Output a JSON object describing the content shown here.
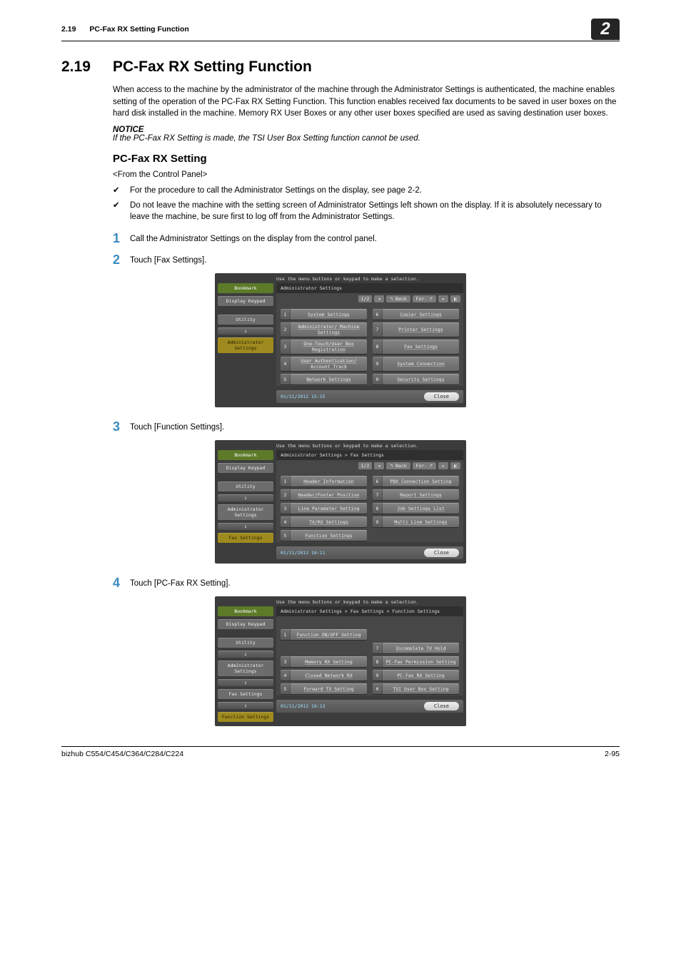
{
  "header": {
    "section_number": "2.19",
    "section_name": "PC-Fax RX Setting Function",
    "chapter_digit": "2"
  },
  "title": {
    "number": "2.19",
    "text": "PC-Fax RX Setting Function"
  },
  "intro": "When access to the machine by the administrator of the machine through the Administrator Settings is authenticated, the machine enables setting of the operation of the PC-Fax RX Setting Function. This function enables received fax documents to be saved in user boxes on the hard disk installed in the machine. Memory RX User Boxes or any other user boxes specified are used as saving destination user boxes.",
  "notice": {
    "label": "NOTICE",
    "text": "If the PC-Fax RX Setting is made, the TSI User Box Setting function cannot be used."
  },
  "subheading": "PC-Fax RX Setting",
  "origin": "<From the Control Panel>",
  "checks": [
    "For the procedure to call the Administrator Settings on the display, see page 2-2.",
    "Do not leave the machine with the setting screen of Administrator Settings left shown on the display. If it is absolutely necessary to leave the machine, be sure first to log off from the Administrator Settings."
  ],
  "steps": [
    {
      "n": "1",
      "text": "Call the Administrator Settings on the display from the control panel."
    },
    {
      "n": "2",
      "text": "Touch [Fax Settings]."
    },
    {
      "n": "3",
      "text": "Touch [Function Settings]."
    },
    {
      "n": "4",
      "text": "Touch [PC-Fax RX Setting]."
    }
  ],
  "common": {
    "hint": "Use the menu buttons or keypad to make a selection.",
    "bookmark": "Bookmark",
    "display_keypad": "Display Keypad",
    "utility": "Utility",
    "admin_settings": "Administrator Settings",
    "fax_settings": "Fax Settings",
    "function_settings": "Function Settings",
    "back": "↰ Back",
    "forw": "For- ↱",
    "close": "Close",
    "arrow_down": "↓"
  },
  "screen1": {
    "crumb": "Administrator Settings",
    "page": "1/2",
    "timestamp": "01/11/2012   15:15",
    "items": [
      {
        "n": "1",
        "t": "System Settings"
      },
      {
        "n": "6",
        "t": "Copier Settings"
      },
      {
        "n": "2",
        "t": "Administrator/ Machine Settings"
      },
      {
        "n": "7",
        "t": "Printer Settings"
      },
      {
        "n": "3",
        "t": "One-Touch/User Box Registration"
      },
      {
        "n": "8",
        "t": "Fax Settings"
      },
      {
        "n": "4",
        "t": "User Authentication/ Account Track"
      },
      {
        "n": "9",
        "t": "System Connection"
      },
      {
        "n": "5",
        "t": "Network Settings"
      },
      {
        "n": "0",
        "t": "Security Settings"
      }
    ]
  },
  "screen2": {
    "crumb": "Administrator Settings  >  Fax Settings",
    "page": "1/2",
    "timestamp": "01/11/2012   16:11",
    "items": [
      {
        "n": "1",
        "t": "Header Information"
      },
      {
        "n": "6",
        "t": "PBX Connection Setting"
      },
      {
        "n": "2",
        "t": "Header/Footer Position"
      },
      {
        "n": "7",
        "t": "Report Settings"
      },
      {
        "n": "3",
        "t": "Line Parameter Setting"
      },
      {
        "n": "8",
        "t": "Job Settings List"
      },
      {
        "n": "4",
        "t": "TX/RX Settings"
      },
      {
        "n": "9",
        "t": "Multi Line Settings"
      },
      {
        "n": "5",
        "t": "Function Settings"
      },
      {
        "n": "",
        "t": ""
      }
    ]
  },
  "screen3": {
    "crumb": "Administrator Settings > Fax Settings > Function Settings",
    "page": "",
    "timestamp": "01/11/2012   16:12",
    "items": [
      {
        "n": "1",
        "t": "Function ON/OFF Setting"
      },
      {
        "n": "",
        "t": ""
      },
      {
        "n": "",
        "t": ""
      },
      {
        "n": "7",
        "t": "Incomplete TX Hold"
      },
      {
        "n": "3",
        "t": "Memory RX Setting"
      },
      {
        "n": "8",
        "t": "PC-Fax Permission Setting"
      },
      {
        "n": "4",
        "t": "Closed Network RX"
      },
      {
        "n": "9",
        "t": "PC-Fax RX Setting"
      },
      {
        "n": "5",
        "t": "Forward TX Setting"
      },
      {
        "n": "0",
        "t": "TSI User Box Setting"
      }
    ]
  },
  "footer": {
    "model": "bizhub C554/C454/C364/C284/C224",
    "page": "2-95"
  }
}
